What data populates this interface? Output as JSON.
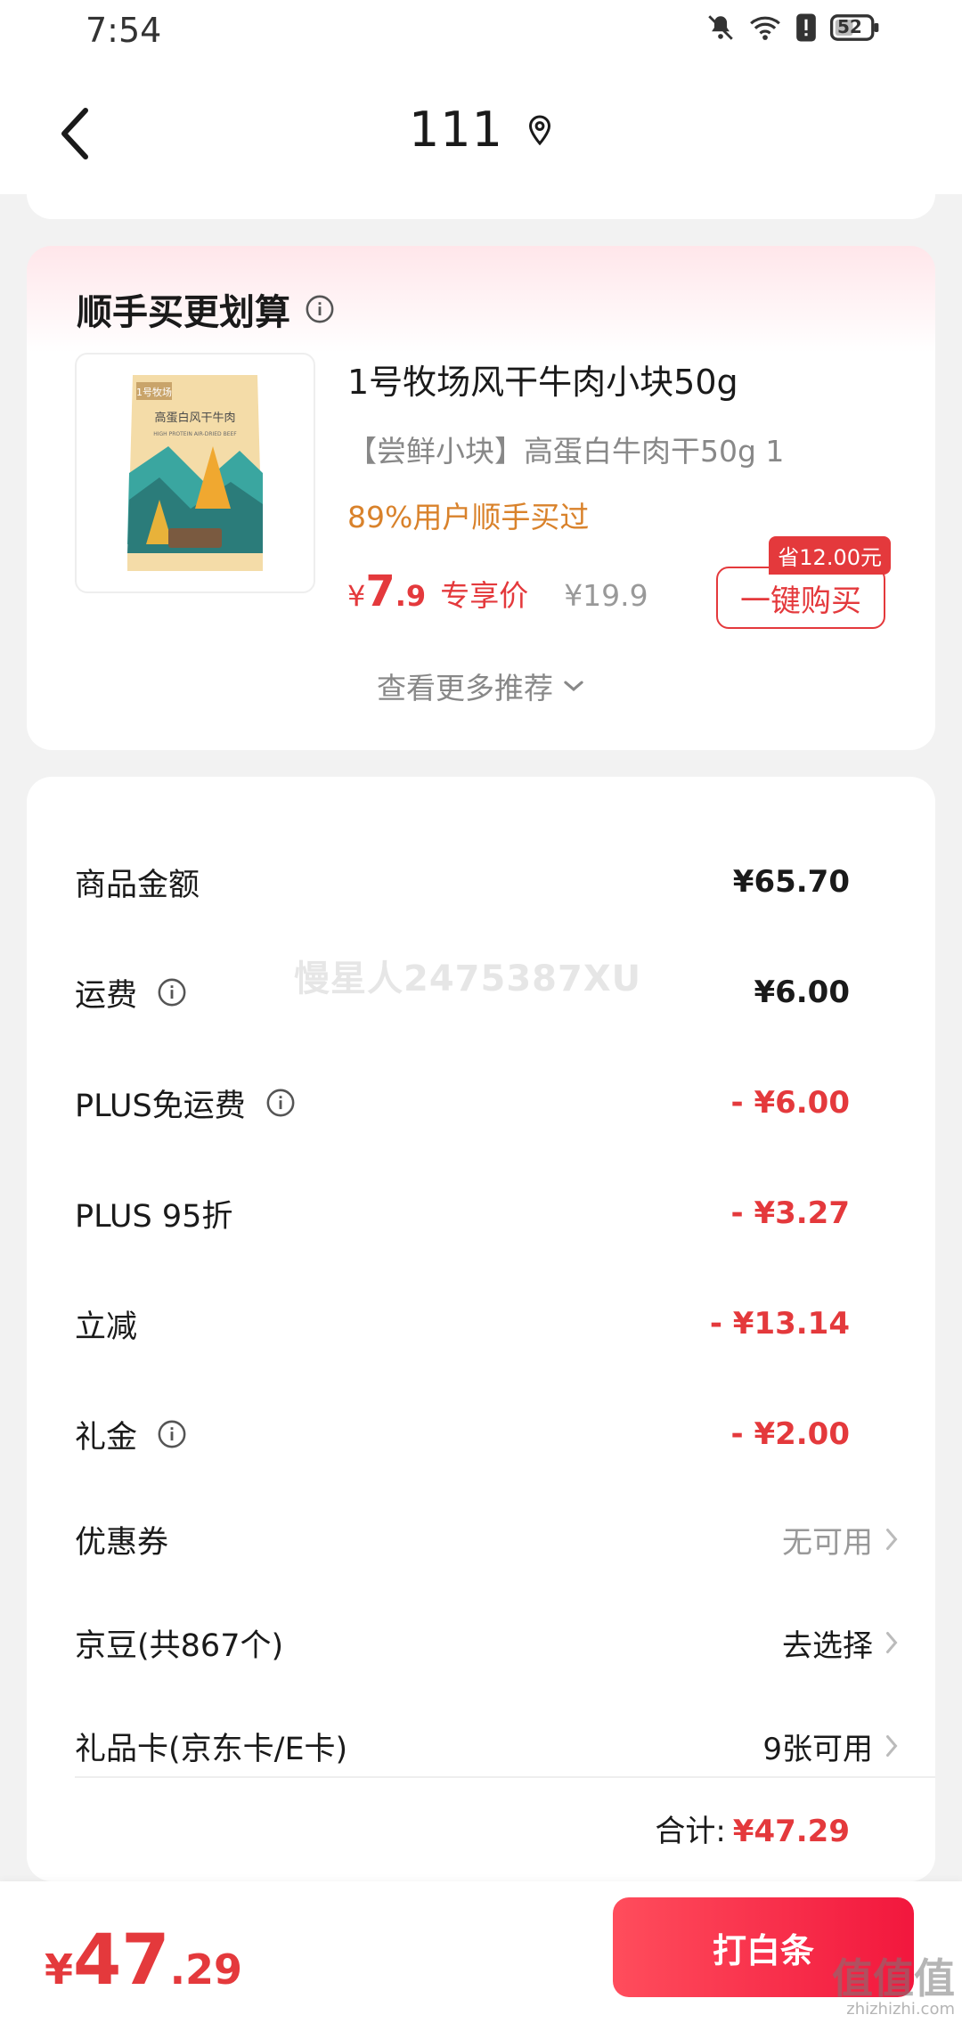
{
  "status_bar": {
    "time": "7:54",
    "battery": "52",
    "icons": [
      "mute-icon",
      "wifi-icon",
      "alert-icon",
      "battery-icon"
    ]
  },
  "header": {
    "title": "111",
    "icons": [
      "back-icon",
      "location-icon"
    ]
  },
  "recommendation": {
    "title": "顺手买更划算",
    "product": {
      "name": "1号牧场风干牛肉小块50g",
      "description": "【尝鲜小块】高蛋白牛肉干50g   1",
      "social_proof": "89%用户顺手买过",
      "price_symbol": "¥",
      "price_int": "7",
      "price_dec": ".9",
      "price_tag": "专享价",
      "original_price": "¥19.9",
      "save_badge": "省12.00元",
      "buy_label": "一键购买",
      "package_brand": "1号牧场",
      "package_title": "高蛋白风干牛肉",
      "package_subtitle": "HIGH PROTEIN AIR-DRIED BEEF"
    },
    "more_label": "查看更多推荐"
  },
  "summary": {
    "rows": [
      {
        "label": "商品金额",
        "value": "¥65.70"
      },
      {
        "label": "运费",
        "value": "¥6.00"
      },
      {
        "label": "PLUS免运费",
        "value": "- ¥6.00"
      },
      {
        "label": "PLUS 95折",
        "value": "- ¥3.27"
      },
      {
        "label": "立减",
        "value": "- ¥13.14"
      },
      {
        "label": "礼金",
        "value": "- ¥2.00"
      }
    ],
    "link_rows": [
      {
        "label": "优惠券",
        "value": "无可用"
      },
      {
        "label": "京豆(共867个)",
        "value": "去选择"
      },
      {
        "label": "礼品卡(京东卡/E卡)",
        "value": "9张可用"
      }
    ],
    "total_label": "合计:",
    "total_value": "¥47.29",
    "watermark": "慢星人2475387XU"
  },
  "bottom_bar": {
    "price_symbol": "¥",
    "price_int": "47",
    "price_dec": ".29",
    "pay_label": "打白条",
    "site_mark": "值值值",
    "site_url": "zhizhizhi.com"
  },
  "colors": {
    "accent": "#e4393c",
    "orange": "#d9822b",
    "pay_gradient_start": "#ff4d5c",
    "pay_gradient_end": "#f2173d"
  }
}
